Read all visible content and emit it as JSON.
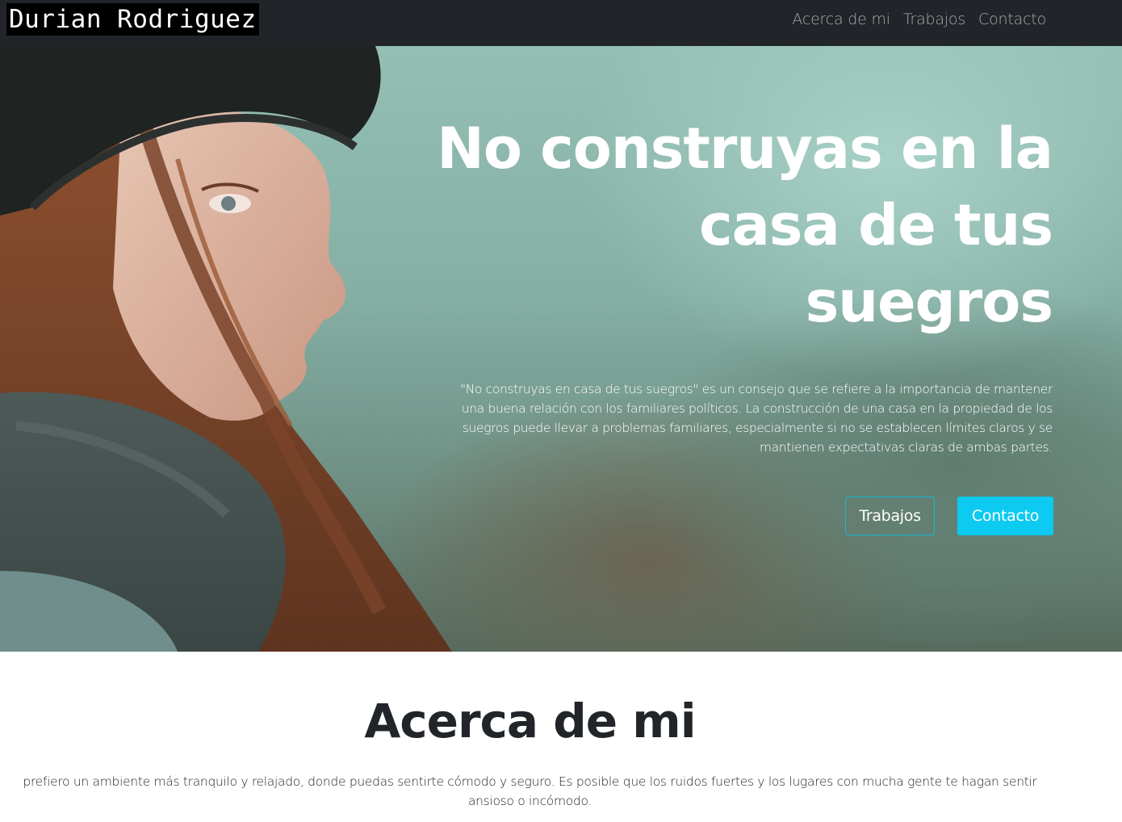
{
  "navbar": {
    "brand": "Durian Rodriguez",
    "links": [
      {
        "label": "Acerca de mi"
      },
      {
        "label": "Trabajos"
      },
      {
        "label": "Contacto"
      }
    ]
  },
  "hero": {
    "title_lines": [
      "No construyas en la",
      "casa de tus",
      "suegros"
    ],
    "text": "\"No construyas en casa de tus suegros\" es un consejo que se refiere a la importancia de mantener una buena relación con los familiares políticos. La construcción de una casa en la propiedad de los suegros puede llevar a problemas familiares, especialmente si no se establecen límites claros y se mantienen expectativas claras de ambas partes.",
    "buttons": {
      "outline": "Trabajos",
      "solid": "Contacto"
    }
  },
  "about": {
    "title": "Acerca de mi",
    "text": "prefiero un ambiente más tranquilo y relajado, donde puedas sentirte cómodo y seguro. Es posible que los ruidos fuertes y los lugares con mucha gente te hagan sentir ansioso o incómodo."
  },
  "colors": {
    "navbar_bg": "#212529",
    "nav_link": "#a6a8ab",
    "accent_cyan": "#0dcaf0",
    "text_dark": "#212529"
  }
}
